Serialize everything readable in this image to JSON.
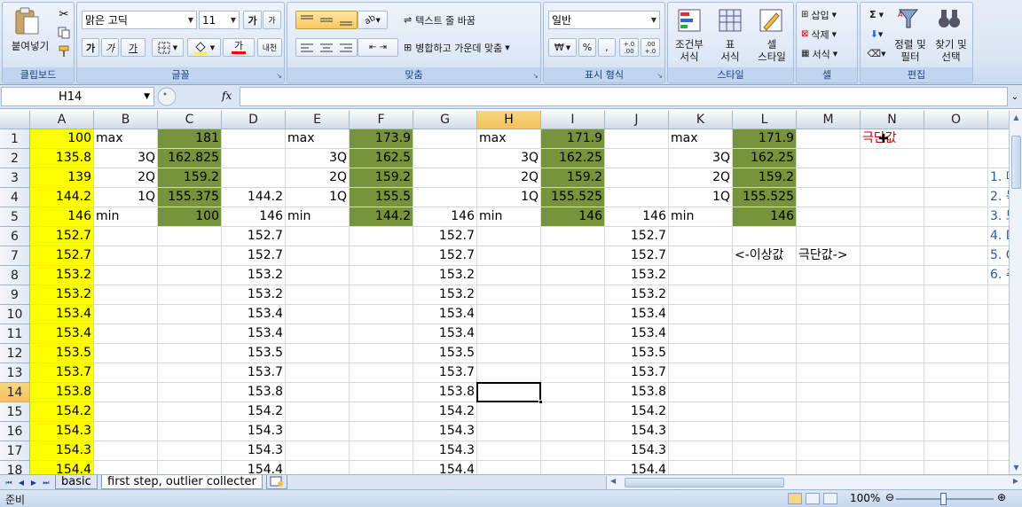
{
  "ribbon": {
    "clipboard": {
      "paste_label": "붙여넣기",
      "group_label": "클립보드"
    },
    "font": {
      "font_name": "맑은 고딕",
      "font_size": "11",
      "group_label": "글꼴",
      "grow_label": "가",
      "shrink_label": "가",
      "bold_label": "가",
      "italic_label": "가",
      "underline_label": "가",
      "font_color_label": "가",
      "phonetic_label": "내천"
    },
    "alignment": {
      "wrap_text_label": "텍스트 줄 바꿈",
      "merge_label": "병합하고 가운데 맞춤",
      "group_label": "맞춤"
    },
    "number": {
      "format_value": "일반",
      "currency_label": "₩",
      "percent_label": "%",
      "comma_label": ",",
      "inc_decimal_label": "+.0 .00",
      "dec_decimal_label": ".00 +.0",
      "group_label": "표시 형식"
    },
    "styles": {
      "conditional_label_1": "조건부",
      "conditional_label_2": "서식",
      "table_label_1": "표",
      "table_label_2": "서식",
      "cell_style_label_1": "셀",
      "cell_style_label_2": "스타일",
      "group_label": "스타일"
    },
    "cells": {
      "insert_label": "삽입",
      "delete_label": "삭제",
      "format_label": "서식",
      "group_label": "셀"
    },
    "editing": {
      "sort_label_1": "정렬 및",
      "sort_label_2": "필터",
      "find_label_1": "찾기 및",
      "find_label_2": "선택",
      "group_label": "편집",
      "sum_label": "Σ"
    }
  },
  "formula_bar": {
    "name_box": "H14",
    "fx_label": "fx",
    "formula": ""
  },
  "grid": {
    "columns": [
      "A",
      "B",
      "C",
      "D",
      "E",
      "F",
      "G",
      "H",
      "I",
      "J",
      "K",
      "L",
      "M",
      "N",
      "O"
    ],
    "active_column": "H",
    "rows": [
      "1",
      "2",
      "3",
      "4",
      "5",
      "6",
      "7",
      "8",
      "9",
      "10",
      "11",
      "12",
      "13",
      "14",
      "15",
      "16",
      "17",
      "18"
    ],
    "active_row": "14",
    "cells": {
      "A": [
        "100",
        "135.8",
        "139",
        "144.2",
        "146",
        "152.7",
        "152.7",
        "153.2",
        "153.2",
        "153.4",
        "153.4",
        "153.5",
        "153.7",
        "153.8",
        "154.2",
        "154.3",
        "154.3",
        "154.4"
      ],
      "B": [
        "max",
        "3Q",
        "2Q",
        "1Q",
        "min"
      ],
      "C": [
        "181",
        "162.825",
        "159.2",
        "155.375",
        "100"
      ],
      "D": [
        "",
        "",
        "",
        "144.2",
        "146",
        "152.7",
        "152.7",
        "153.2",
        "153.2",
        "153.4",
        "153.4",
        "153.5",
        "153.7",
        "153.8",
        "154.2",
        "154.3",
        "154.3",
        "154.4"
      ],
      "E": [
        "max",
        "3Q",
        "2Q",
        "1Q",
        "min"
      ],
      "F": [
        "173.9",
        "162.5",
        "159.2",
        "155.5",
        "144.2"
      ],
      "G": [
        "",
        "",
        "",
        "",
        "146",
        "152.7",
        "152.7",
        "153.2",
        "153.2",
        "153.4",
        "153.4",
        "153.5",
        "153.7",
        "153.8",
        "154.2",
        "154.3",
        "154.3",
        "154.4"
      ],
      "H": [
        "max",
        "3Q",
        "2Q",
        "1Q",
        "min"
      ],
      "I": [
        "171.9",
        "162.25",
        "159.2",
        "155.525",
        "146"
      ],
      "J": [
        "",
        "",
        "",
        "",
        "146",
        "152.7",
        "152.7",
        "153.2",
        "153.2",
        "153.4",
        "153.4",
        "153.5",
        "153.7",
        "153.8",
        "154.2",
        "154.3",
        "154.3",
        "154.4"
      ],
      "K": [
        "max",
        "3Q",
        "2Q",
        "1Q",
        "min"
      ],
      "L": [
        "171.9",
        "162.25",
        "159.2",
        "155.525",
        "146"
      ],
      "L7": "<-이상값",
      "M7": "극단값->",
      "N1": "극단값",
      "P_partial": [
        "1. 데",
        "2. 목",
        "3. 보",
        "4. D",
        "5. C",
        "6. 추"
      ]
    }
  },
  "sheet_tabs": {
    "tabs": [
      "basic",
      "first step, outlier collecter"
    ],
    "active_index": 1
  },
  "status_bar": {
    "status": "준비",
    "zoom": "100%"
  },
  "colors": {
    "yellow_fill": "#ffff00",
    "green_fill": "#77933c",
    "active_header": "#f1c15f",
    "red_text": "#c00000"
  }
}
